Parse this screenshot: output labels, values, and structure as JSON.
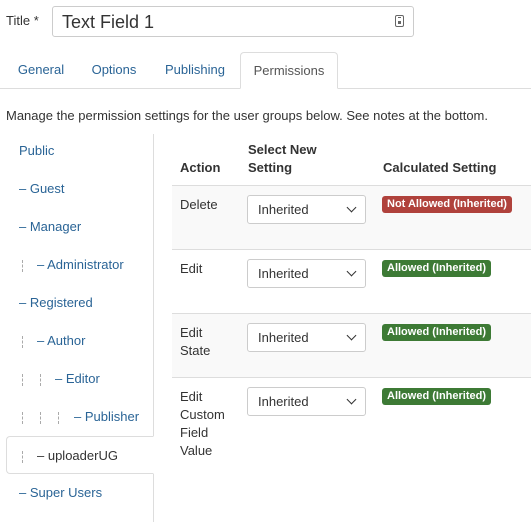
{
  "title_field": {
    "label": "Title *",
    "value": "Text Field 1",
    "icon": "lock-icon"
  },
  "tabs": [
    {
      "label": "General"
    },
    {
      "label": "Options"
    },
    {
      "label": "Publishing"
    },
    {
      "label": "Permissions",
      "active": true
    }
  ],
  "description": "Manage the permission settings for the user groups below. See notes at the bottom.",
  "groups": [
    {
      "label": "Public"
    },
    {
      "label": "– Guest"
    },
    {
      "label": "– Manager"
    },
    {
      "label": "– Administrator"
    },
    {
      "label": "– Registered"
    },
    {
      "label": "– Author"
    },
    {
      "label": "– Editor"
    },
    {
      "label": "– Publisher"
    },
    {
      "label": "– uploaderUG",
      "active": true
    },
    {
      "label": "– Super Users"
    }
  ],
  "table": {
    "headers": {
      "action": "Action",
      "select_line1": "Select New",
      "select_line2": "Setting",
      "calculated": "Calculated Setting"
    },
    "rows": [
      {
        "action": [
          "Delete"
        ],
        "setting": "Inherited",
        "calculated": "Not Allowed (Inherited)",
        "status": "denied"
      },
      {
        "action": [
          "Edit"
        ],
        "setting": "Inherited",
        "calculated": "Allowed (Inherited)",
        "status": "allowed"
      },
      {
        "action": [
          "Edit",
          "State"
        ],
        "setting": "Inherited",
        "calculated": "Allowed (Inherited)",
        "status": "allowed"
      },
      {
        "action": [
          "Edit",
          "Custom",
          "Field",
          "Value"
        ],
        "setting": "Inherited",
        "calculated": "Allowed (Inherited)",
        "status": "allowed"
      }
    ]
  },
  "colors": {
    "link": "#2a6496",
    "allowed": "#3d7a35",
    "denied": "#b0423c",
    "border": "#dddddd"
  }
}
